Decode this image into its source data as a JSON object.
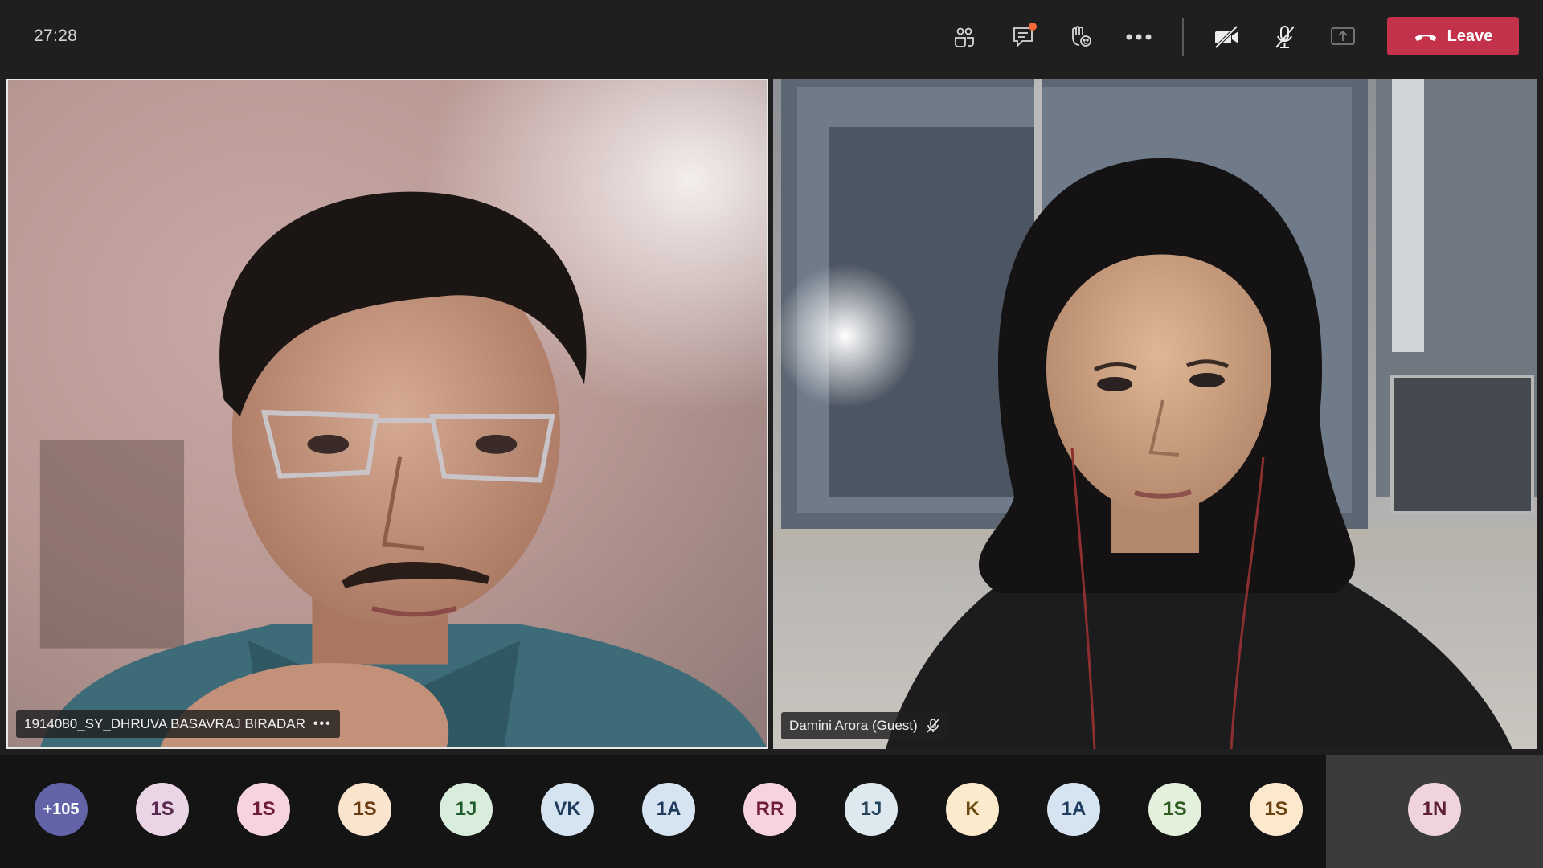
{
  "meeting": {
    "timer": "27:28",
    "toolbar": {
      "people_icon": "people-icon",
      "chat_icon": "chat-icon",
      "reactions_icon": "raise-hand-icon",
      "more_icon": "more-options-icon",
      "camera_icon": "camera-off-icon",
      "mic_icon": "mic-off-icon",
      "share_icon": "share-screen-icon",
      "leave_label": "Leave",
      "leave_color": "#c4314b",
      "chat_notification_color": "#f36a3b"
    }
  },
  "participants": {
    "left_tile": {
      "name": "1914080_SY_DHRUVA BASAVRAJ BIRADAR",
      "more_label": "•••"
    },
    "right_tile": {
      "name": "Damini Arora (Guest)",
      "mic_icon": "mic-muted-icon"
    }
  },
  "strip": {
    "avatars": [
      {
        "initials": "+105",
        "bg": "#6264a7",
        "fg": "#ffffff"
      },
      {
        "initials": "1S",
        "bg": "#ead5e6",
        "fg": "#5b2a50"
      },
      {
        "initials": "1S",
        "bg": "#f7d3de",
        "fg": "#6e1d3a"
      },
      {
        "initials": "1S",
        "bg": "#fbe4cd",
        "fg": "#6a3b12"
      },
      {
        "initials": "1J",
        "bg": "#d8eddb",
        "fg": "#1e5b2a"
      },
      {
        "initials": "VK",
        "bg": "#d6e3f0",
        "fg": "#1f3b5e"
      },
      {
        "initials": "1A",
        "bg": "#d6e3f0",
        "fg": "#1f3b5e"
      },
      {
        "initials": "RR",
        "bg": "#f7d3de",
        "fg": "#6e1d3a"
      },
      {
        "initials": "1J",
        "bg": "#dde8ef",
        "fg": "#23435a"
      },
      {
        "initials": "K",
        "bg": "#fbeacb",
        "fg": "#6a4a10"
      },
      {
        "initials": "1A",
        "bg": "#d6e3f0",
        "fg": "#1f3b5e"
      },
      {
        "initials": "1S",
        "bg": "#e2f0dc",
        "fg": "#2f5a22"
      },
      {
        "initials": "1S",
        "bg": "#fbe8cd",
        "fg": "#6a4210"
      },
      {
        "initials": "1N",
        "bg": "#f0d4dc",
        "fg": "#5e1f33"
      }
    ]
  }
}
